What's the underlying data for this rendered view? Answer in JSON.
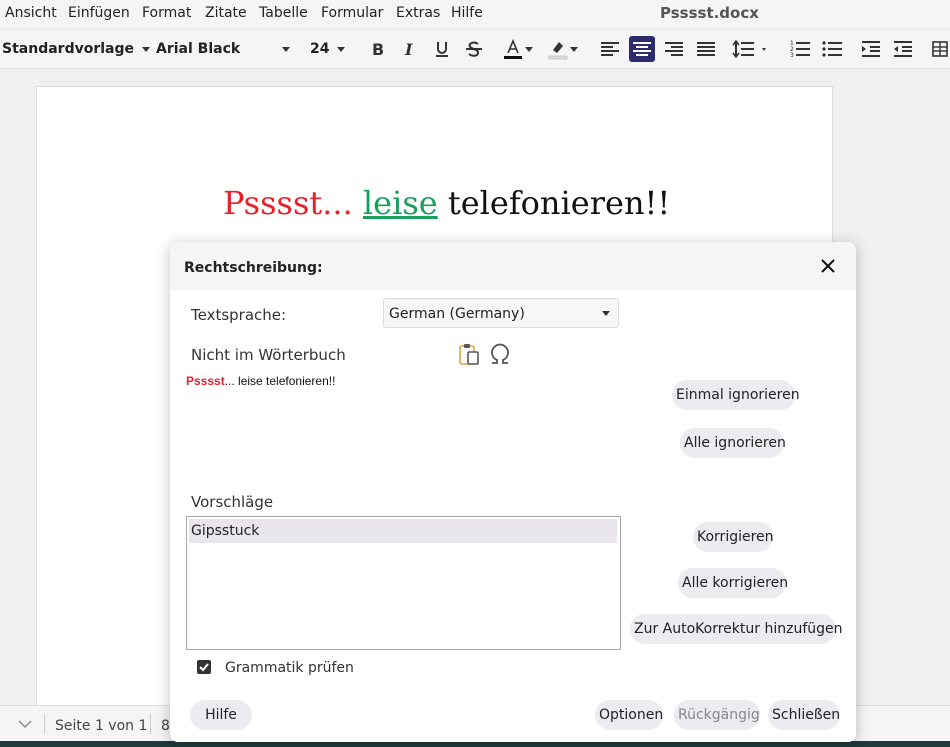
{
  "menubar": {
    "items": [
      "Ansicht",
      "Einfügen",
      "Format",
      "Zitate",
      "Tabelle",
      "Formular",
      "Extras",
      "Hilfe"
    ],
    "doc_title": "Psssst.docx"
  },
  "toolbar": {
    "style_value": "Standardvorlage",
    "font_value": "Arial Black",
    "size_value": "24",
    "active_button": "align-center"
  },
  "document": {
    "heading": {
      "word1": "Psssst...",
      "word2": "leise",
      "word3": "telefonieren!!"
    },
    "colors": {
      "error": "#e8202a",
      "green": "#19a05a"
    }
  },
  "statusbar": {
    "page_text": "Seite 1 von 1",
    "partial": "8"
  },
  "dialog": {
    "title": "Rechtschreibung:",
    "language_label": "Textsprache:",
    "language_value": "German (Germany)",
    "not_in_dict_label": "Nicht im Wörterbuch",
    "sentence": {
      "error_word": "Psssst",
      "rest": "... leise telefonieren!!"
    },
    "buttons": {
      "ignore_once": "Einmal ignorieren",
      "ignore_all": "Alle ignorieren",
      "correct": "Korrigieren",
      "correct_all": "Alle korrigieren",
      "add_autocorrect": "Zur AutoKorrektur hinzufügen",
      "help": "Hilfe",
      "options": "Optionen",
      "undo": "Rückgängig",
      "close": "Schließen"
    },
    "suggestions_label": "Vorschläge",
    "suggestions": [
      "Gipsstuck"
    ],
    "grammar_label": "Grammatik prüfen",
    "grammar_checked": true
  }
}
